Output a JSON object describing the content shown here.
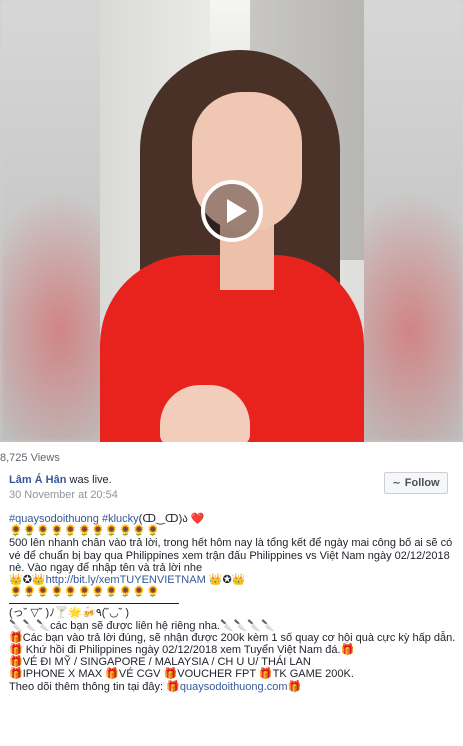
{
  "post": {
    "views": "8,725 Views",
    "author_name": "Lâm Á Hân",
    "author_status": " was live.",
    "date": "30 November at 20:54",
    "follow_label": "Follow",
    "hashtag1": "#quaysodoithuong",
    "hashtag2": "#klucky",
    "face_emoticon": "(ↀ‿ↀ)ა ❤️",
    "sunflowers": "🌻🌻🌻🌻🌻🌻🌻🌻🌻🌻🌻",
    "body_text": "500 lên nhanh chân vào trả lời, trong hết hôm nay là tổng kết để ngày mai công bố ai sẽ có vé để chuẩn bị bay qua Philippines xem trận đấu Philippines vs Việt Nam ngày 02/12/2018 nè. Vào ngay để nhập tên và trả lời nhe",
    "link_prefix_emoji": "👑✪👑",
    "link": "http://bit.ly/xemTUYENVIETNAM",
    "link_suffix_emoji": "👑✪👑",
    "sunflowers2": "🌻🌻🌻🌻🌻🌻🌻🌻🌻🌻🌻",
    "kaomoji_line": "(っ˘ ▽˘ )ﾉ🍸🌟🍻٩(˘◡˘ )",
    "contact_line": "🔪🔪🔪các bạn sẽ được liên hệ riêng nha.🔪🔪🔪🔪",
    "prize_line1": "🎁Các bạn vào trả lời đúng, sẽ nhận được 200k kèm 1 số quay cơ hội quà cực kỳ hấp dẫn.",
    "prize_line2": "🎁 Khứ hồi đi Philippines ngày 02/12/2018 xem Tuyển Việt Nam đá.🎁",
    "prize_line3": "🎁VÉ ĐI MỸ / SINGAPORE / MALAYSIA / CH U U/ THÁI LAN",
    "prize_line4": "🎁IPHONE X MAX 🎁VÉ CGV 🎁VOUCHER FPT 🎁TK GAME 200K.",
    "follow_more_prefix": "Theo dõi thêm thông tin tại đây: 🎁",
    "follow_more_link": "quaysodoithuong.com",
    "follow_more_suffix": "🎁"
  }
}
